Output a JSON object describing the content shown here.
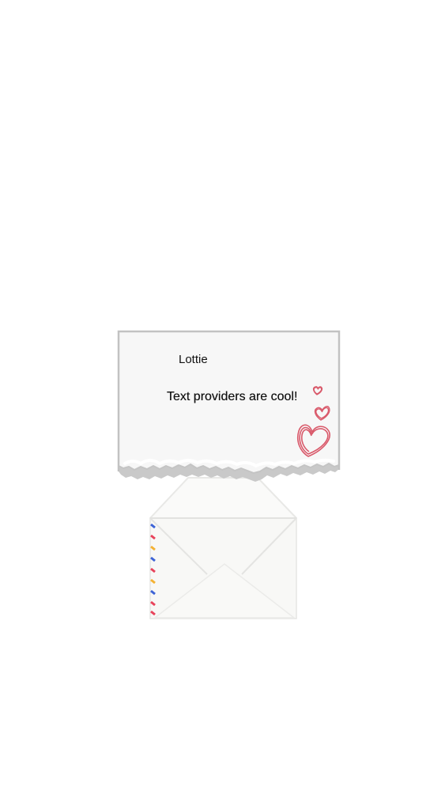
{
  "letter": {
    "title": "Lottie",
    "message": "Text providers are cool!"
  },
  "colors": {
    "background": "#ffffff",
    "paper": "#f7f7f7",
    "paper_border": "#c4c4c4",
    "envelope": "#f8f8f6",
    "envelope_line": "#e6e6e4",
    "stripe_red": "#e8435b",
    "stripe_blue": "#3d63d6",
    "stripe_yellow": "#f4b233",
    "heart": "#d9596a"
  },
  "icons": [
    "heart-icon",
    "envelope-icon",
    "airmail-stripes-icon"
  ]
}
